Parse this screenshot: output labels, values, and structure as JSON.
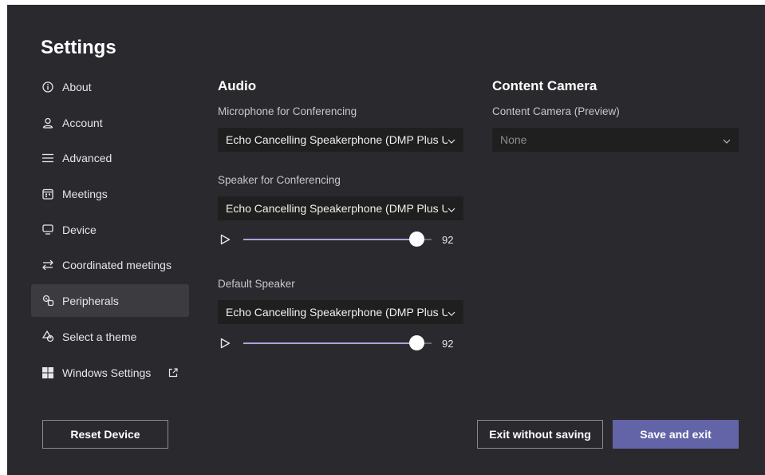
{
  "page": {
    "title": "Settings"
  },
  "nav": {
    "items": [
      {
        "label": "About",
        "icon": "info-icon",
        "selected": false
      },
      {
        "label": "Account",
        "icon": "person-icon",
        "selected": false
      },
      {
        "label": "Advanced",
        "icon": "list-icon",
        "selected": false
      },
      {
        "label": "Meetings",
        "icon": "calendar-icon",
        "selected": false
      },
      {
        "label": "Device",
        "icon": "monitor-icon",
        "selected": false
      },
      {
        "label": "Coordinated meetings",
        "icon": "swap-arrows-icon",
        "selected": false
      },
      {
        "label": "Peripherals",
        "icon": "peripherals-icon",
        "selected": true
      },
      {
        "label": "Select a theme",
        "icon": "theme-icon",
        "selected": false
      },
      {
        "label": "Windows Settings",
        "icon": "windows-logo-icon",
        "selected": false,
        "trailing_icon": "external-link-icon"
      }
    ]
  },
  "audio": {
    "title": "Audio",
    "microphone": {
      "label": "Microphone for Conferencing",
      "value": "Echo Cancelling Speakerphone (DMP Plus US..."
    },
    "speaker": {
      "label": "Speaker for Conferencing",
      "value": "Echo Cancelling Speakerphone (DMP Plus US...",
      "volume": 92
    },
    "default_speaker": {
      "label": "Default Speaker",
      "value": "Echo Cancelling Speakerphone (DMP Plus US...",
      "volume": 92
    }
  },
  "content_camera": {
    "title": "Content Camera",
    "label": "Content Camera (Preview)",
    "value": "None"
  },
  "buttons": {
    "reset": "Reset Device",
    "exit_without_saving": "Exit without saving",
    "save_and_exit": "Save and exit"
  },
  "colors": {
    "background": "#2a292d",
    "accent": "#6264a7",
    "selected_nav": "#3c3b40",
    "dropdown": "#1f1f1f"
  }
}
